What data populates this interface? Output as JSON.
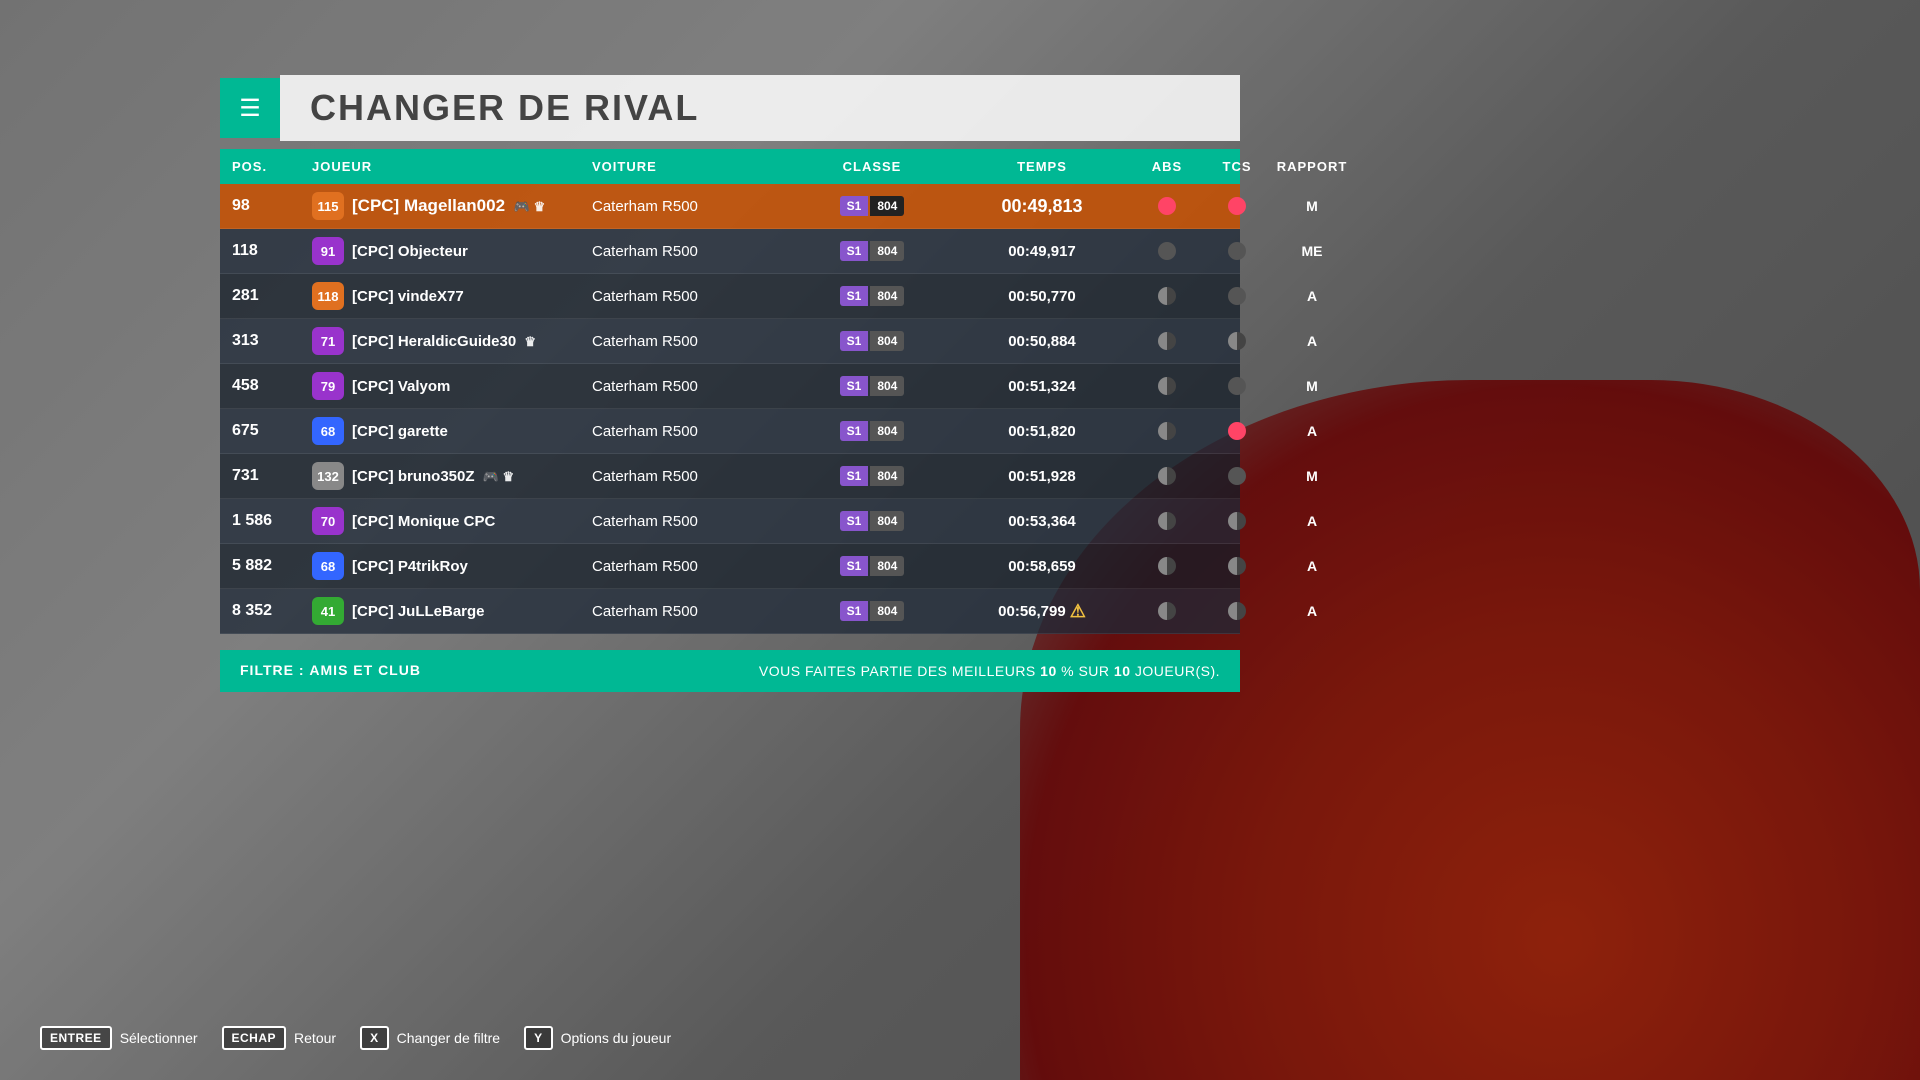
{
  "header": {
    "icon": "☰",
    "title": "CHANGER DE RIVAL"
  },
  "columns": [
    {
      "key": "pos",
      "label": "POS.",
      "align": "left"
    },
    {
      "key": "joueur",
      "label": "JOUEUR",
      "align": "left"
    },
    {
      "key": "voiture",
      "label": "VOITURE",
      "align": "left"
    },
    {
      "key": "classe",
      "label": "CLASSE",
      "align": "center"
    },
    {
      "key": "temps",
      "label": "TEMPS",
      "align": "center"
    },
    {
      "key": "abs",
      "label": "ABS",
      "align": "center"
    },
    {
      "key": "tcs",
      "label": "TCS",
      "align": "center"
    },
    {
      "key": "rapport",
      "label": "RAPPORT",
      "align": "center"
    }
  ],
  "rows": [
    {
      "pos": "98",
      "level": "115",
      "level_color": "#e07020",
      "name": "[CPC] Magellan002",
      "icons": "🎮 ♛",
      "voiture": "Caterham R500",
      "classe": "S1",
      "rating": "804",
      "temps": "00:49,813",
      "abs": "active",
      "tcs": "active",
      "rapport": "M",
      "selected": true
    },
    {
      "pos": "118",
      "level": "91",
      "level_color": "#9933cc",
      "name": "[CPC] Objecteur",
      "icons": "",
      "voiture": "Caterham R500",
      "classe": "S1",
      "rating": "804",
      "temps": "00:49,917",
      "abs": "inactive",
      "tcs": "inactive",
      "rapport": "ME",
      "selected": false
    },
    {
      "pos": "281",
      "level": "118",
      "level_color": "#e07020",
      "name": "[CPC] vindeX77",
      "icons": "",
      "voiture": "Caterham R500",
      "classe": "S1",
      "rating": "804",
      "temps": "00:50,770",
      "abs": "half",
      "tcs": "inactive",
      "rapport": "A",
      "selected": false
    },
    {
      "pos": "313",
      "level": "71",
      "level_color": "#9933cc",
      "name": "[CPC] HeraldicGuide30",
      "icons": "♛",
      "voiture": "Caterham R500",
      "classe": "S1",
      "rating": "804",
      "temps": "00:50,884",
      "abs": "half",
      "tcs": "half",
      "rapport": "A",
      "selected": false
    },
    {
      "pos": "458",
      "level": "79",
      "level_color": "#9933cc",
      "name": "[CPC] Valyom",
      "icons": "",
      "voiture": "Caterham R500",
      "classe": "S1",
      "rating": "804",
      "temps": "00:51,324",
      "abs": "half",
      "tcs": "inactive",
      "rapport": "M",
      "selected": false
    },
    {
      "pos": "675",
      "level": "68",
      "level_color": "#3366ff",
      "name": "[CPC] garette",
      "icons": "",
      "voiture": "Caterham R500",
      "classe": "S1",
      "rating": "804",
      "temps": "00:51,820",
      "abs": "half",
      "tcs": "active",
      "rapport": "A",
      "selected": false
    },
    {
      "pos": "731",
      "level": "132",
      "level_color": "#888",
      "name": "[CPC] bruno350Z",
      "icons": "🎮 ♛",
      "voiture": "Caterham R500",
      "classe": "S1",
      "rating": "804",
      "temps": "00:51,928",
      "abs": "half",
      "tcs": "inactive",
      "rapport": "M",
      "selected": false
    },
    {
      "pos": "1 586",
      "level": "70",
      "level_color": "#9933cc",
      "name": "[CPC] Monique CPC",
      "icons": "",
      "voiture": "Caterham R500",
      "classe": "S1",
      "rating": "804",
      "temps": "00:53,364",
      "abs": "half",
      "tcs": "half",
      "rapport": "A",
      "selected": false
    },
    {
      "pos": "5 882",
      "level": "68",
      "level_color": "#3366ff",
      "name": "[CPC] P4trikRoy",
      "icons": "",
      "voiture": "Caterham R500",
      "classe": "S1",
      "rating": "804",
      "temps": "00:58,659",
      "abs": "half",
      "tcs": "half",
      "rapport": "A",
      "selected": false
    },
    {
      "pos": "8 352",
      "level": "41",
      "level_color": "#33aa33",
      "name": "[CPC] JuLLeBarge",
      "icons": "",
      "voiture": "Caterham R500",
      "classe": "S1",
      "rating": "804",
      "temps": "00:56,799",
      "warning": true,
      "abs": "half",
      "tcs": "half",
      "rapport": "A",
      "selected": false
    }
  ],
  "filter": {
    "label": "FILTRE : ",
    "value": "AMIS ET CLUB",
    "stats_text": "VOUS FAITES PARTIE DES MEILLEURS ",
    "pct": "10",
    "sur": " % SUR ",
    "total": "10",
    "joueurs": " JOUEUR(S)."
  },
  "controls": [
    {
      "key": "ENTREE",
      "label": "Sélectionner"
    },
    {
      "key": "ECHAP",
      "label": "Retour"
    },
    {
      "key": "X",
      "label": "Changer de filtre"
    },
    {
      "key": "Y",
      "label": "Options du joueur"
    }
  ]
}
